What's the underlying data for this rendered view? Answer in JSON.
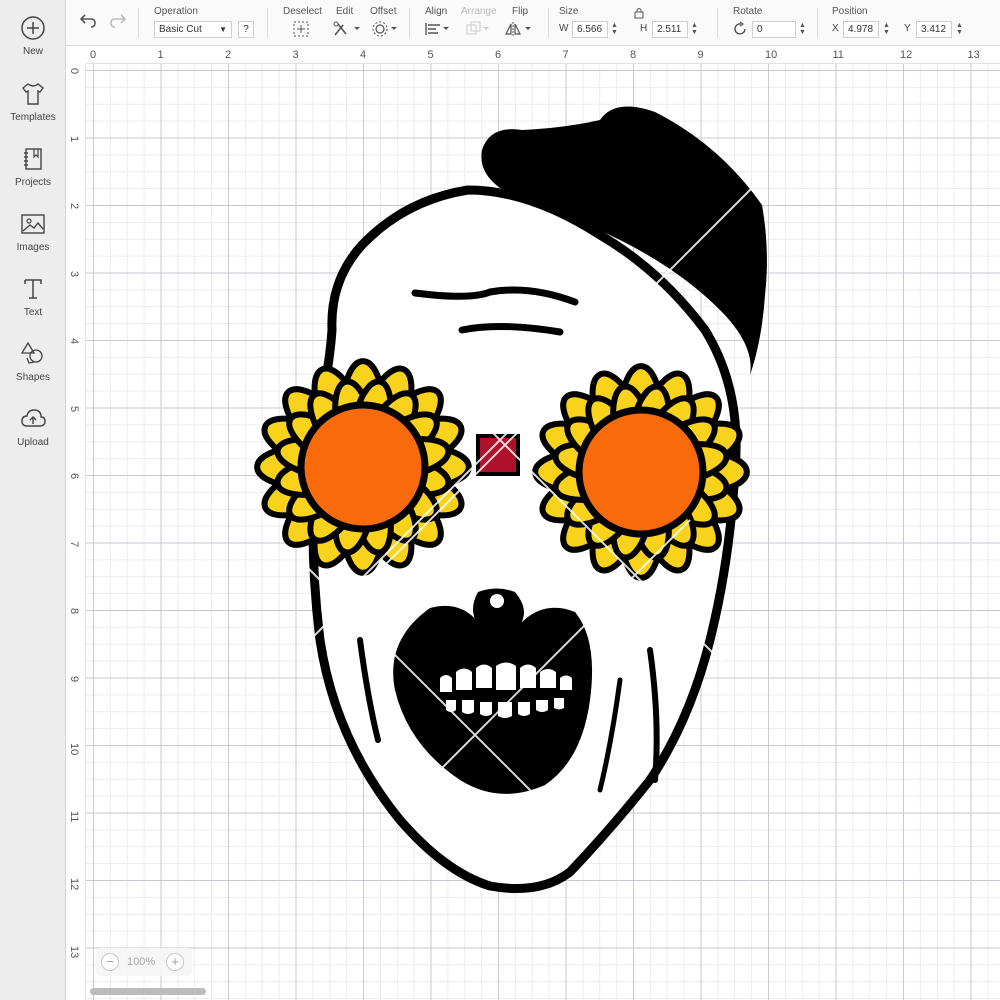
{
  "sidebar": {
    "items": [
      {
        "label": "New",
        "icon": "plus-circle-icon"
      },
      {
        "label": "Templates",
        "icon": "tshirt-icon"
      },
      {
        "label": "Projects",
        "icon": "notebook-icon"
      },
      {
        "label": "Images",
        "icon": "image-icon"
      },
      {
        "label": "Text",
        "icon": "text-t-icon"
      },
      {
        "label": "Shapes",
        "icon": "shapes-icon"
      },
      {
        "label": "Upload",
        "icon": "cloud-upload-icon"
      }
    ]
  },
  "toolbar": {
    "operation_label": "Operation",
    "operation_value": "Basic Cut",
    "help": "?",
    "deselect_label": "Deselect",
    "edit_label": "Edit",
    "offset_label": "Offset",
    "align_label": "Align",
    "arrange_label": "Arrange",
    "flip_label": "Flip",
    "size_label": "Size",
    "w_label": "W",
    "w_value": "6.566",
    "h_label": "H",
    "h_value": "2.511",
    "rotate_label": "Rotate",
    "rotate_value": "0",
    "position_label": "Position",
    "x_label": "X",
    "x_value": "4.978",
    "y_label": "Y",
    "y_value": "3.412"
  },
  "ruler": {
    "top": [
      "0",
      "1",
      "2",
      "3",
      "4",
      "5",
      "6",
      "7",
      "8",
      "9",
      "10",
      "11",
      "12",
      "13"
    ],
    "left": [
      "0",
      "1",
      "2",
      "3",
      "4",
      "5",
      "6",
      "7",
      "8",
      "9",
      "10",
      "11",
      "12",
      "13"
    ]
  },
  "zoom": {
    "minus": "−",
    "value": "100%",
    "plus": "+"
  },
  "colors": {
    "petal": "#f9d31b",
    "center": "#f96a0a",
    "outline": "#000000",
    "bridge": "#b0112a"
  }
}
